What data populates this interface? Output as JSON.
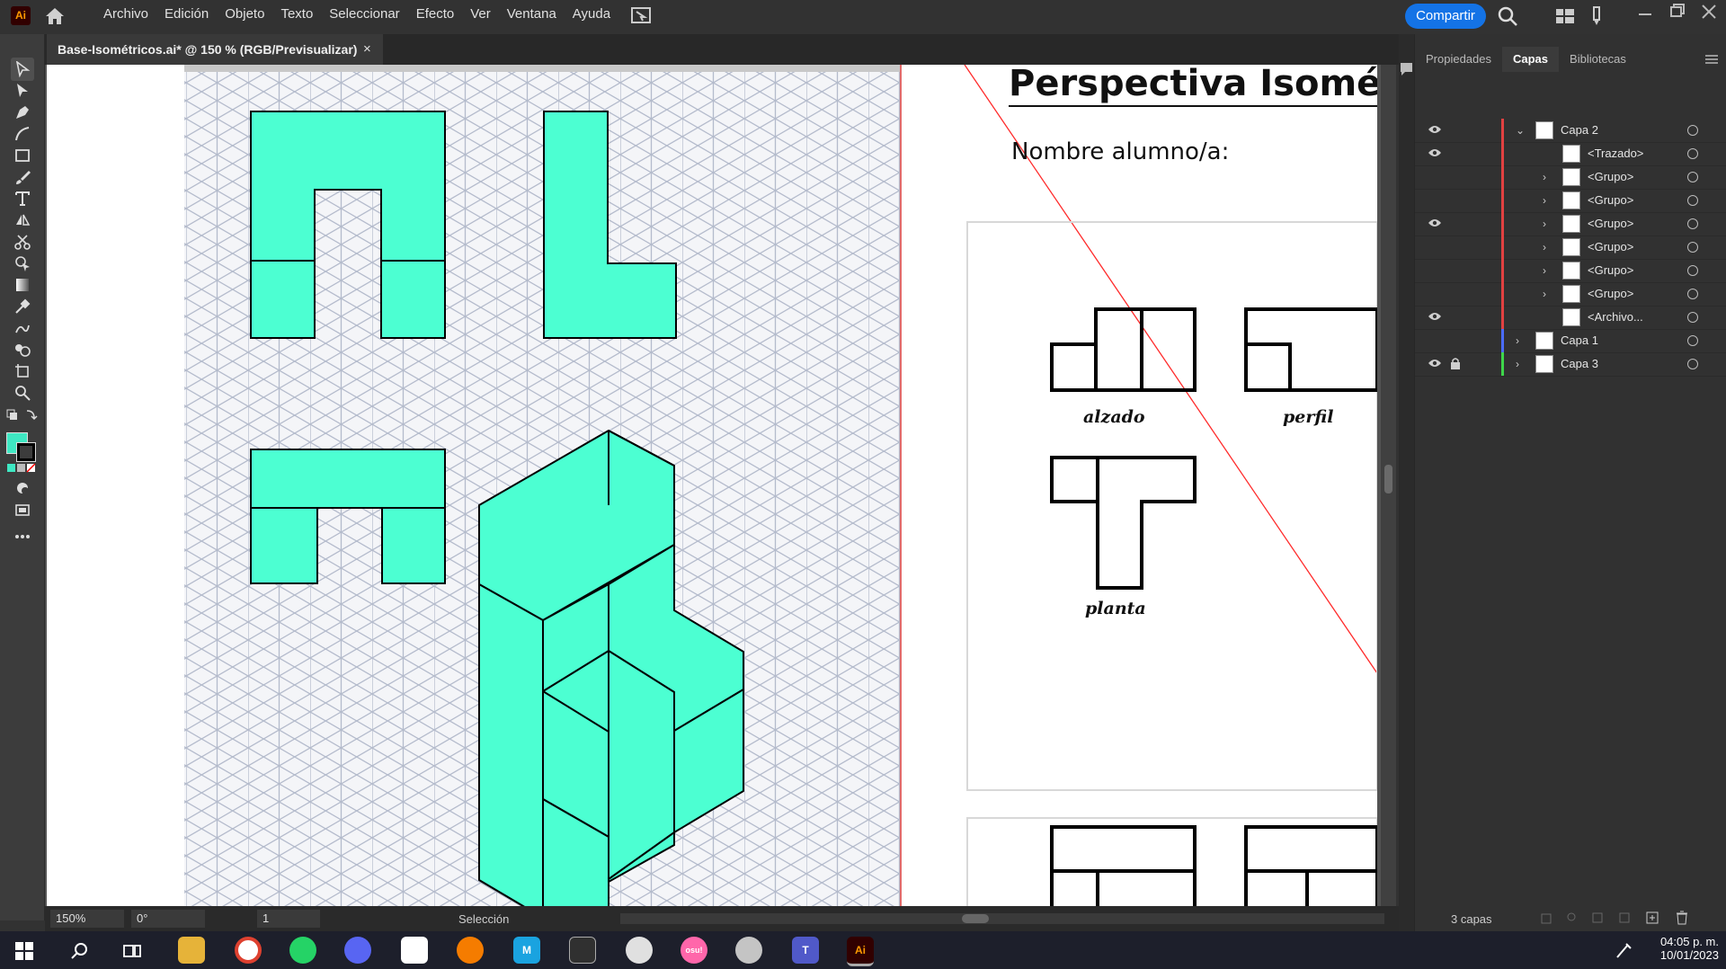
{
  "app": {
    "logo": "Ai"
  },
  "menu": [
    "Archivo",
    "Edición",
    "Objeto",
    "Texto",
    "Seleccionar",
    "Efecto",
    "Ver",
    "Ventana",
    "Ayuda"
  ],
  "share_label": "Compartir",
  "document_tab": {
    "title": "Base-Isométricos.ai* @ 150 % (RGB/Previsualizar)",
    "close": "×"
  },
  "colors": {
    "accent": "#1473e6",
    "shape_fill": "#4cffd2",
    "fill_swatch": "#3fe8c3"
  },
  "artboard": {
    "title": "Perspectiva Isométric",
    "name_label": "Nombre alumno/a:",
    "view_labels": {
      "alzado": "alzado",
      "perfil": "perfil",
      "planta": "planta"
    }
  },
  "status": {
    "zoom": "150%",
    "rotation": "0°",
    "artboard_num": "1",
    "tool": "Selección"
  },
  "panel": {
    "tabs": [
      "Propiedades",
      "Capas",
      "Bibliotecas"
    ],
    "active_tab": "Capas",
    "layers": [
      {
        "name": "Capa 2",
        "visible": true,
        "chevron": "open",
        "color": "#e14141",
        "indent": 0
      },
      {
        "name": "<Trazado>",
        "visible": true,
        "chevron": "",
        "color": "#e14141",
        "indent": 1
      },
      {
        "name": "<Grupo>",
        "visible": false,
        "chevron": "closed",
        "color": "#e14141",
        "indent": 1
      },
      {
        "name": "<Grupo>",
        "visible": false,
        "chevron": "closed",
        "color": "#e14141",
        "indent": 1
      },
      {
        "name": "<Grupo>",
        "visible": true,
        "chevron": "closed",
        "color": "#e14141",
        "indent": 1
      },
      {
        "name": "<Grupo>",
        "visible": false,
        "chevron": "closed",
        "color": "#e14141",
        "indent": 1
      },
      {
        "name": "<Grupo>",
        "visible": false,
        "chevron": "closed",
        "color": "#e14141",
        "indent": 1
      },
      {
        "name": "<Grupo>",
        "visible": false,
        "chevron": "closed",
        "color": "#e14141",
        "indent": 1
      },
      {
        "name": "<Archivo...",
        "visible": true,
        "chevron": "",
        "color": "#e14141",
        "indent": 1
      },
      {
        "name": "Capa 1",
        "visible": false,
        "chevron": "closed",
        "color": "#4a6cff",
        "indent": 0
      },
      {
        "name": "Capa 3",
        "visible": true,
        "locked": true,
        "chevron": "closed",
        "color": "#3ed64a",
        "indent": 0
      }
    ],
    "footer_count": "3 capas"
  },
  "taskbar": {
    "time": "04:05 p. m.",
    "date": "10/01/2023"
  }
}
